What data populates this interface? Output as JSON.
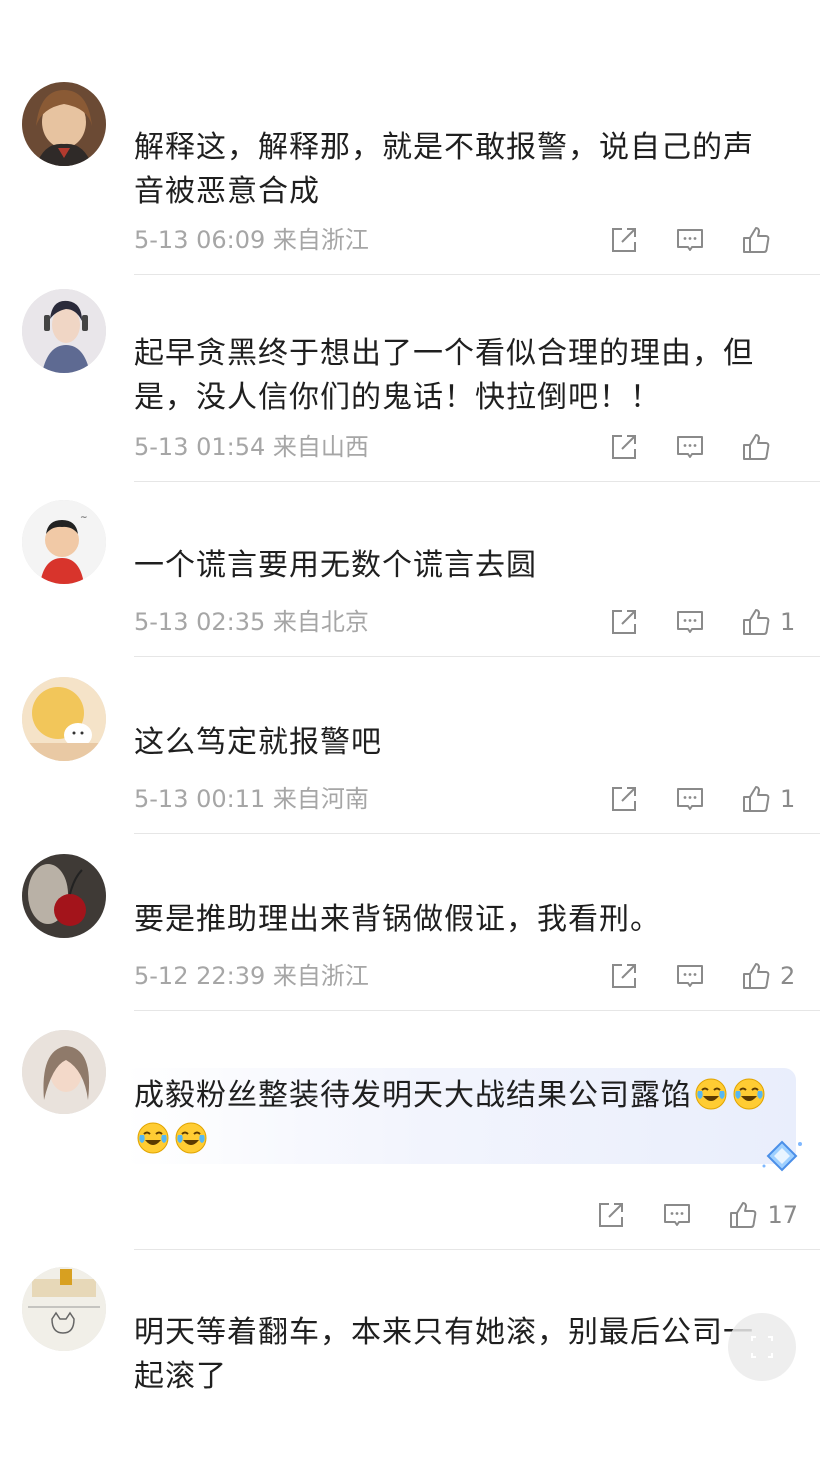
{
  "comments": [
    {
      "text": "解释这，解释那，就是不敢报警，说自己的声音被恶意合成",
      "time": "5-13 06:09",
      "location": "来自浙江",
      "likes": ""
    },
    {
      "text": "起早贪黑终于想出了一个看似合理的理由，但是，没人信你们的鬼话！快拉倒吧！！",
      "time": "5-13 01:54",
      "location": "来自山西",
      "likes": ""
    },
    {
      "text": "一个谎言要用无数个谎言去圆",
      "time": "5-13 02:35",
      "location": "来自北京",
      "likes": "1"
    },
    {
      "text": "这么笃定就报警吧",
      "time": "5-13 00:11",
      "location": "来自河南",
      "likes": "1"
    },
    {
      "text": "要是推助理出来背锅做假证，我看刑。",
      "time": "5-12 22:39",
      "location": "来自浙江",
      "likes": "2"
    },
    {
      "text": "成毅粉丝整装待发明天大战结果公司露馅",
      "time": "",
      "location": "",
      "likes": "17"
    },
    {
      "text": "明天等着翻车，本来只有她滚，别最后公司一起滚了",
      "time": "",
      "location": "",
      "likes": ""
    }
  ],
  "icons": {
    "share": "share-icon",
    "comment": "comment-icon",
    "like": "thumbs-up-icon",
    "emoji": "laughing-crying-emoji"
  },
  "colors": {
    "text": "#1f1f1f",
    "meta": "#a6a6a6",
    "icon": "#8a8a8a",
    "divider": "#e6e6e6",
    "highlight": "#e9eefc"
  }
}
